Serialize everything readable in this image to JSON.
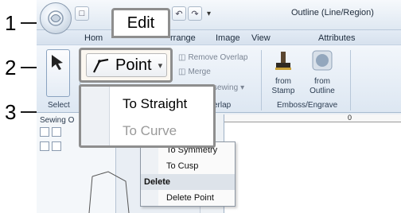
{
  "callouts": {
    "one": "1",
    "two": "2",
    "three": "3"
  },
  "titlebar": {
    "window_title": "Outline (Line/Region)"
  },
  "tabs": {
    "home": "Hom",
    "edit": "Edit",
    "arrange": "rrange",
    "image": "Image",
    "view": "View",
    "attributes": "Attributes"
  },
  "ribbon": {
    "select_label": "Select",
    "select_group": "Select",
    "point_label": "Point",
    "remove_overlap": "Remove Overlap",
    "merge": "Merge",
    "sewing": "sewing",
    "overlap_group": "erlap",
    "from_stamp_1": "from",
    "from_stamp_2": "Stamp",
    "from_outline_1": "from",
    "from_outline_2": "Outline",
    "emboss_group": "Emboss/Engrave"
  },
  "dropdown": {
    "to_straight": "To Straight",
    "to_curve": "To Curve"
  },
  "side_panel": {
    "title": "Sewing O"
  },
  "ruler": {
    "mark": "0"
  },
  "context_menu": {
    "to_symmetry": "To Symmetry",
    "to_cusp": "To Cusp",
    "delete_header": "Delete",
    "delete_point": "Delete Point"
  },
  "colors": {
    "callout_border": "#8e8e8e",
    "ribbon_bg": "#dde7f2",
    "disabled_text": "#9a9a9a"
  }
}
